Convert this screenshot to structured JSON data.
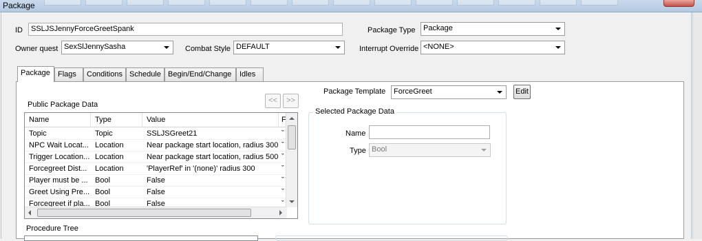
{
  "window": {
    "title": "Package"
  },
  "form": {
    "id_label": "ID",
    "id_value": "SSLJSJennyForceGreetSpank",
    "package_type_label": "Package Type",
    "package_type_value": "Package",
    "owner_quest_label": "Owner quest",
    "owner_quest_value": "SexSlJennySasha",
    "combat_style_label": "Combat Style",
    "combat_style_value": "DEFAULT",
    "interrupt_override_label": "Interrupt Override",
    "interrupt_override_value": "<NONE>"
  },
  "tabs": [
    {
      "label": "Package"
    },
    {
      "label": "Flags"
    },
    {
      "label": "Conditions"
    },
    {
      "label": "Schedule"
    },
    {
      "label": "Begin/End/Change"
    },
    {
      "label": "Idles"
    }
  ],
  "package_tab": {
    "template_label": "Package Template",
    "template_value": "ForceGreet",
    "edit_button": "Edit",
    "public_data_label": "Public Package Data",
    "nav_prev": "<<",
    "nav_next": ">>",
    "columns": [
      "Name",
      "Type",
      "Value",
      "F"
    ],
    "rows": [
      {
        "name": "Topic",
        "type": "Topic",
        "value": "SSLJSGreet21",
        "flag": "ˇ"
      },
      {
        "name": "NPC Wait Locat...",
        "type": "Location",
        "value": "Near package start location, radius 300",
        "flag": "ˇ"
      },
      {
        "name": "Trigger Location...",
        "type": "Location",
        "value": "Near package start location, radius 500",
        "flag": "ˇ"
      },
      {
        "name": "Forcegreet Dist...",
        "type": "Location",
        "value": "'PlayerRef' in '(none)' radius 300",
        "flag": "ˇ"
      },
      {
        "name": "Player must be ...",
        "type": "Bool",
        "value": "False",
        "flag": "ˇ"
      },
      {
        "name": "Greet Using Pre...",
        "type": "Bool",
        "value": "False",
        "flag": "ˇ"
      },
      {
        "name": "Forcegreet if pla...",
        "type": "Bool",
        "value": "False",
        "flag": "ˇ"
      }
    ],
    "selected_group_label": "Selected Package Data",
    "name_label": "Name",
    "name_value": "",
    "type_label": "Type",
    "type_value": "Bool",
    "procedure_tree_label": "Procedure Tree"
  },
  "colors": {
    "titlebar": "#c9d9ec",
    "close_button": "#c75048",
    "panel_background": "#ffffff"
  }
}
